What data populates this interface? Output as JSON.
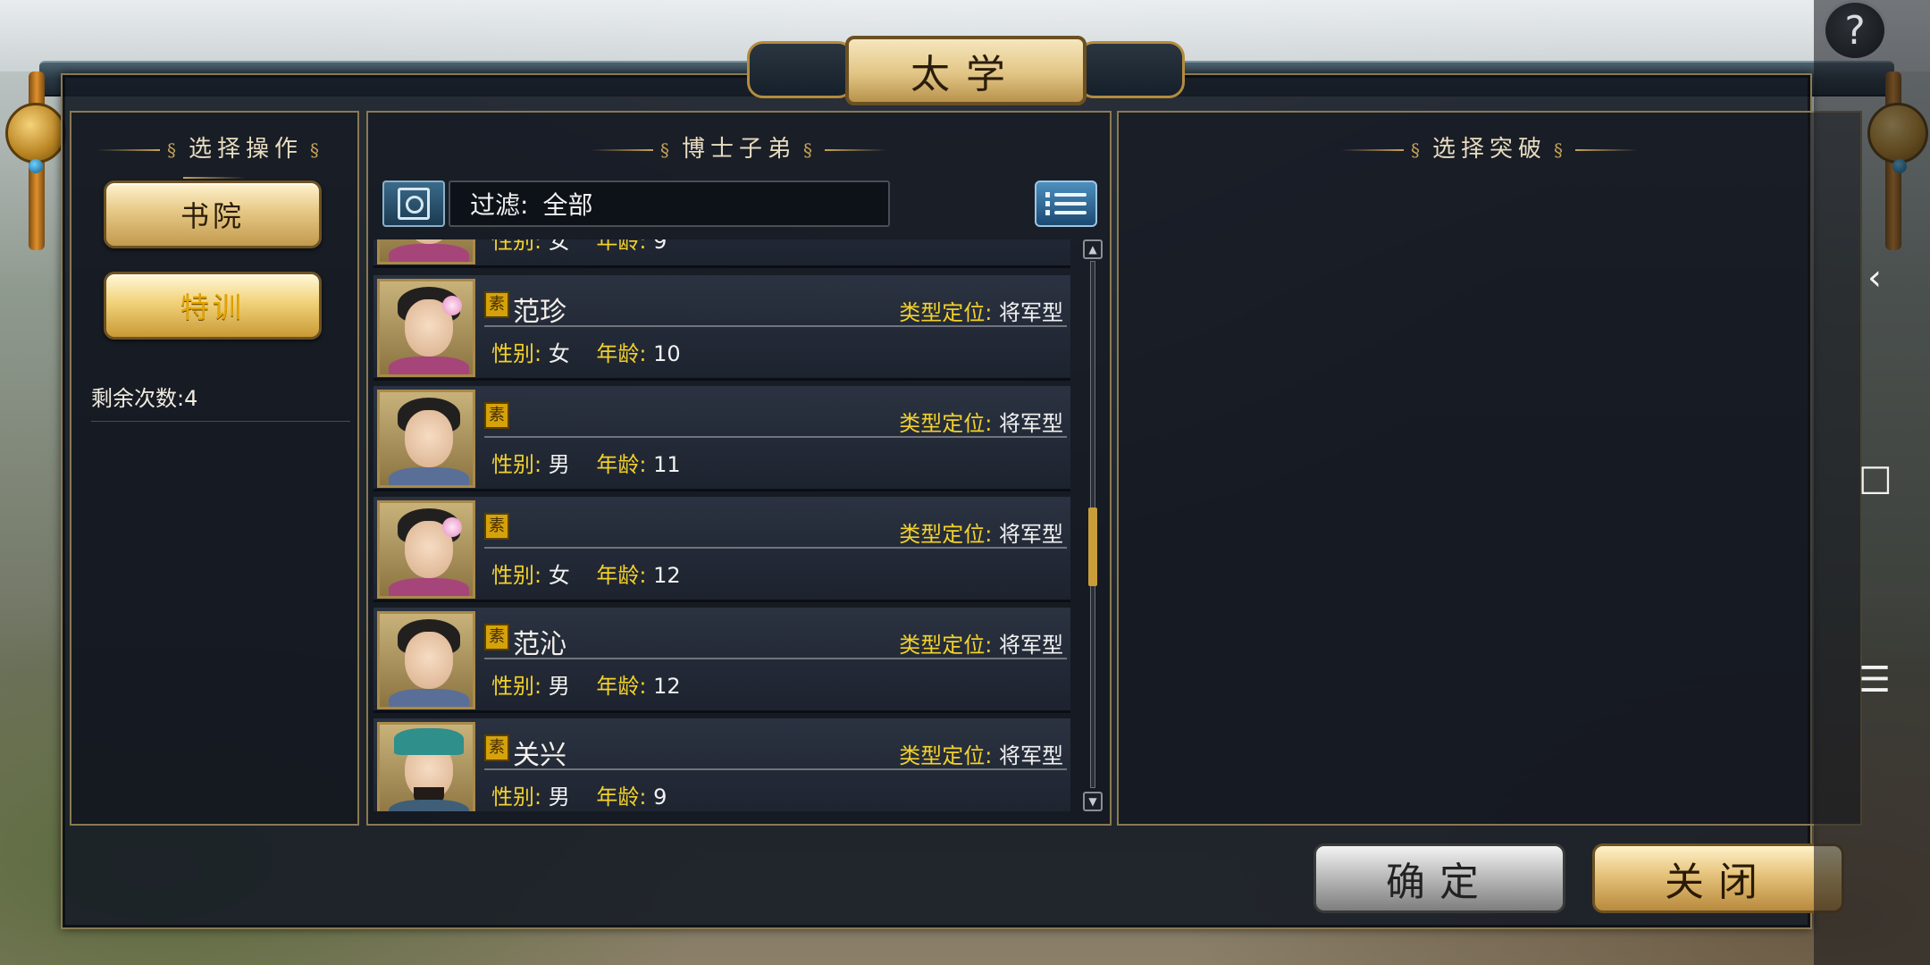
{
  "window": {
    "title": "太学",
    "help": "?"
  },
  "left_panel": {
    "title": "选择操作",
    "buttons": [
      {
        "label": "书院",
        "active": false
      },
      {
        "label": "特训",
        "active": true
      }
    ],
    "remaining": "剩余次数:4"
  },
  "middle_panel": {
    "title": "博士子弟",
    "filter_label": "过滤:",
    "filter_value": "全部",
    "partial_row": {
      "gender_label": "性别:",
      "gender": "女",
      "age_label": "年龄:",
      "age": "9"
    },
    "students": [
      {
        "badge": "素",
        "name": "范珍",
        "type_label": "类型定位:",
        "type": "将军型",
        "gender_label": "性别:",
        "gender": "女",
        "age_label": "年龄:",
        "age": "10"
      },
      {
        "badge": "素",
        "name": "",
        "type_label": "类型定位:",
        "type": "将军型",
        "gender_label": "性别:",
        "gender": "男",
        "age_label": "年龄:",
        "age": "11"
      },
      {
        "badge": "素",
        "name": "",
        "type_label": "类型定位:",
        "type": "将军型",
        "gender_label": "性别:",
        "gender": "女",
        "age_label": "年龄:",
        "age": "12"
      },
      {
        "badge": "素",
        "name": "范沁",
        "type_label": "类型定位:",
        "type": "将军型",
        "gender_label": "性别:",
        "gender": "男",
        "age_label": "年龄:",
        "age": "12"
      },
      {
        "badge": "素",
        "name": "关兴",
        "type_label": "类型定位:",
        "type": "将军型",
        "gender_label": "性别:",
        "gender": "男",
        "age_label": "年龄:",
        "age": "9"
      }
    ]
  },
  "right_panel": {
    "title": "选择突破"
  },
  "footer": {
    "confirm": "确定",
    "close": "关闭"
  },
  "system_nav": {
    "back": "‹",
    "home": "□",
    "menu": "☰"
  },
  "colors": {
    "gold": "#f3d22b",
    "frame": "#8a7a52",
    "panel_bg": "#161c26"
  }
}
